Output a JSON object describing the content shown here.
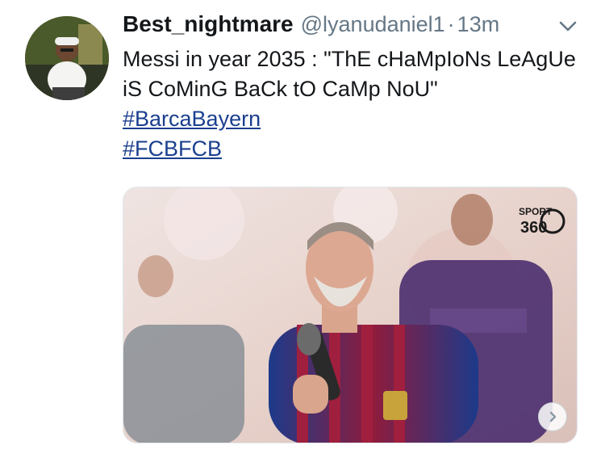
{
  "tweet": {
    "display_name": "Best_nightmare",
    "handle": "@lyanudaniel1",
    "separator": "·",
    "time": "13m",
    "text": "Messi in year 2035 : \"ThE cHaMpIoNs LeAgUe iS CoMinG BaCk tO CaMp NoU\"",
    "hashtags": [
      "#BarcaBayern",
      "#FCBFCB"
    ]
  },
  "media": {
    "logo_text_top": "SPORT",
    "logo_text_bottom": "360"
  },
  "colors": {
    "accent": "#1b3f8f",
    "secondary_text": "#657786",
    "primary_text": "#14171a"
  },
  "icons": [
    "chevron-down-icon",
    "chevron-right-icon"
  ]
}
